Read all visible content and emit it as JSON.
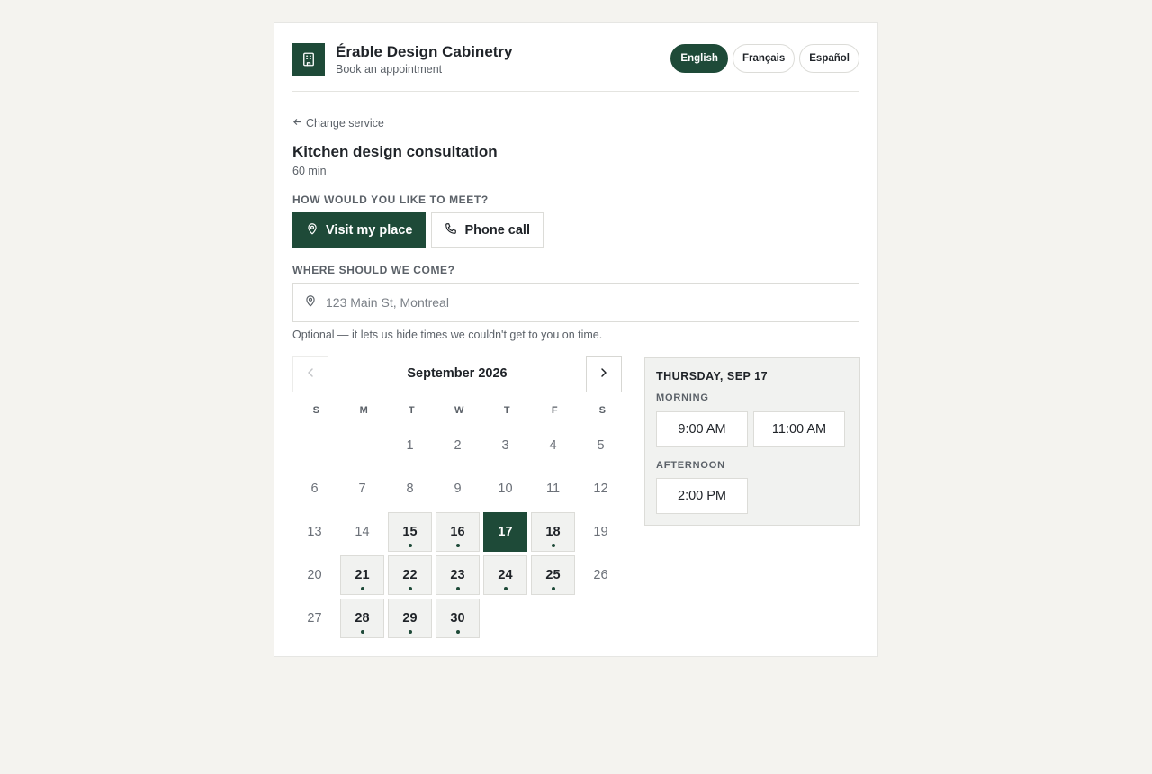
{
  "business": {
    "name": "Érable Design Cabinetry",
    "subtitle": "Book an appointment",
    "logo_icon": "building-icon"
  },
  "languages": [
    {
      "label": "English",
      "active": true
    },
    {
      "label": "Français",
      "active": false
    },
    {
      "label": "Español",
      "active": false
    }
  ],
  "service": {
    "back_label": "Change service",
    "title": "Kitchen design consultation",
    "duration": "60 min"
  },
  "meeting": {
    "question": "HOW WOULD YOU LIKE TO MEET?",
    "options": [
      {
        "label": "Visit my place",
        "icon": "map-pin-icon",
        "active": true
      },
      {
        "label": "Phone call",
        "icon": "phone-icon",
        "active": false
      }
    ]
  },
  "address": {
    "label": "WHERE SHOULD WE COME?",
    "value": "",
    "placeholder": "123 Main St, Montreal",
    "hint": "Optional — it lets us hide times we couldn't get to you on time."
  },
  "calendar": {
    "month": "September 2026",
    "weekdays": [
      "S",
      "M",
      "T",
      "W",
      "T",
      "F",
      "S"
    ],
    "leading_blanks": 2,
    "days": 30,
    "available": [
      15,
      16,
      17,
      18,
      21,
      22,
      23,
      24,
      25,
      28,
      29,
      30
    ],
    "selected": 17
  },
  "times": {
    "date_label": "THURSDAY, SEP 17",
    "morning_label": "MORNING",
    "morning_slots": [
      "9:00 AM",
      "11:00 AM"
    ],
    "afternoon_label": "AFTERNOON",
    "afternoon_slots": [
      "2:00 PM"
    ]
  },
  "colors": {
    "accent": "#1e4a38",
    "page_bg": "#f4f3ef",
    "muted_text": "#5b6168"
  }
}
